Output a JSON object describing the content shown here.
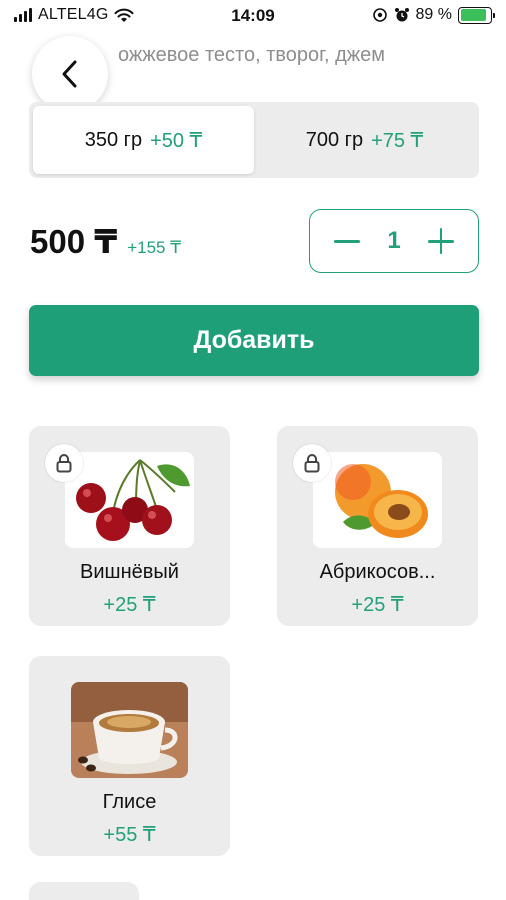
{
  "status_bar": {
    "carrier": "ALTEL4G",
    "time": "14:09",
    "battery_percent": "89 %",
    "battery_level": 0.89
  },
  "product": {
    "description": "ожжевое тесто, творог, джем"
  },
  "sizes": [
    {
      "label": "350 гр",
      "extra": "+50 ₸",
      "active": true
    },
    {
      "label": "700 гр",
      "extra": "+75 ₸",
      "active": false
    }
  ],
  "price": {
    "main": "500 ₸",
    "extra": "+155 ₸"
  },
  "stepper": {
    "quantity": "1"
  },
  "add_button": {
    "label": "Добавить"
  },
  "toppings": [
    {
      "name": "Вишнёвый",
      "extra": "+25 ₸",
      "image": "cherry",
      "locked": true
    },
    {
      "name": "Абрикосов...",
      "extra": "+25 ₸",
      "image": "apricot",
      "locked": true
    },
    {
      "name": "Глисе",
      "extra": "+55 ₸",
      "image": "coffee-cup",
      "locked": false
    }
  ],
  "colors": {
    "accent": "#1e9f78",
    "accent_text": "#22a07a",
    "card_bg": "#ececec"
  }
}
